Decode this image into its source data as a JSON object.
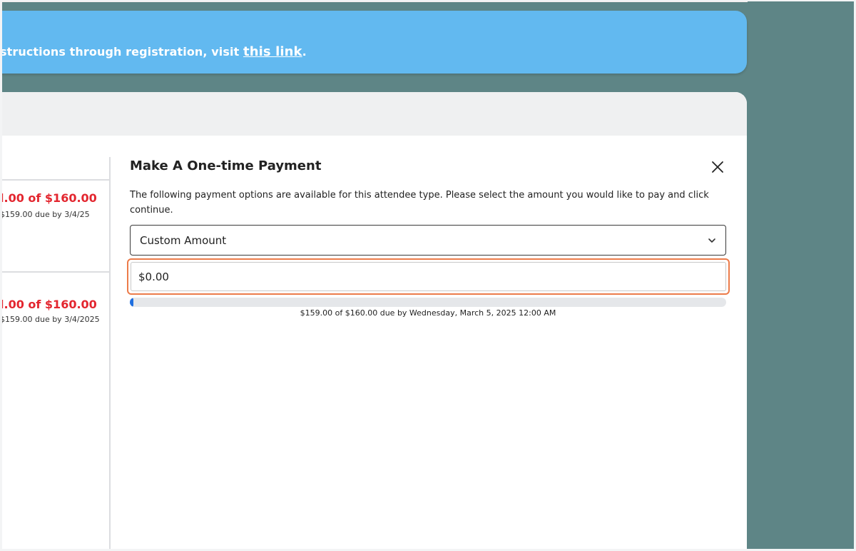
{
  "banner": {
    "text": "structions through registration, visit ",
    "link_label": "this link",
    "trailing": "."
  },
  "left_cards": [
    {
      "amount": "l.00 of $160.00",
      "due": "$159.00 due by 3/4/25"
    },
    {
      "amount": "l.00 of $160.00",
      "due": "$159.00 due by 3/4/2025"
    }
  ],
  "modal": {
    "title": "Make A One-time Payment",
    "description": "The following payment options are available for this attendee type. Please select the amount you would like to pay and click continue.",
    "select": {
      "value": "Custom Amount"
    },
    "amount_input": {
      "value": "$0.00"
    },
    "progress": {
      "fraction": 0.00625,
      "caption": "$159.00 of $160.00 due by Wednesday, March 5, 2025 12:00 AM"
    }
  },
  "colors": {
    "banner": "#62b9f0",
    "background": "#5e8586",
    "amount_red": "#e3262f",
    "focus_outline": "#ec7b4a",
    "progress_fill": "#1f6fe0"
  },
  "icons": {
    "close": "close-icon",
    "dropdown": "chevron-down-icon"
  }
}
